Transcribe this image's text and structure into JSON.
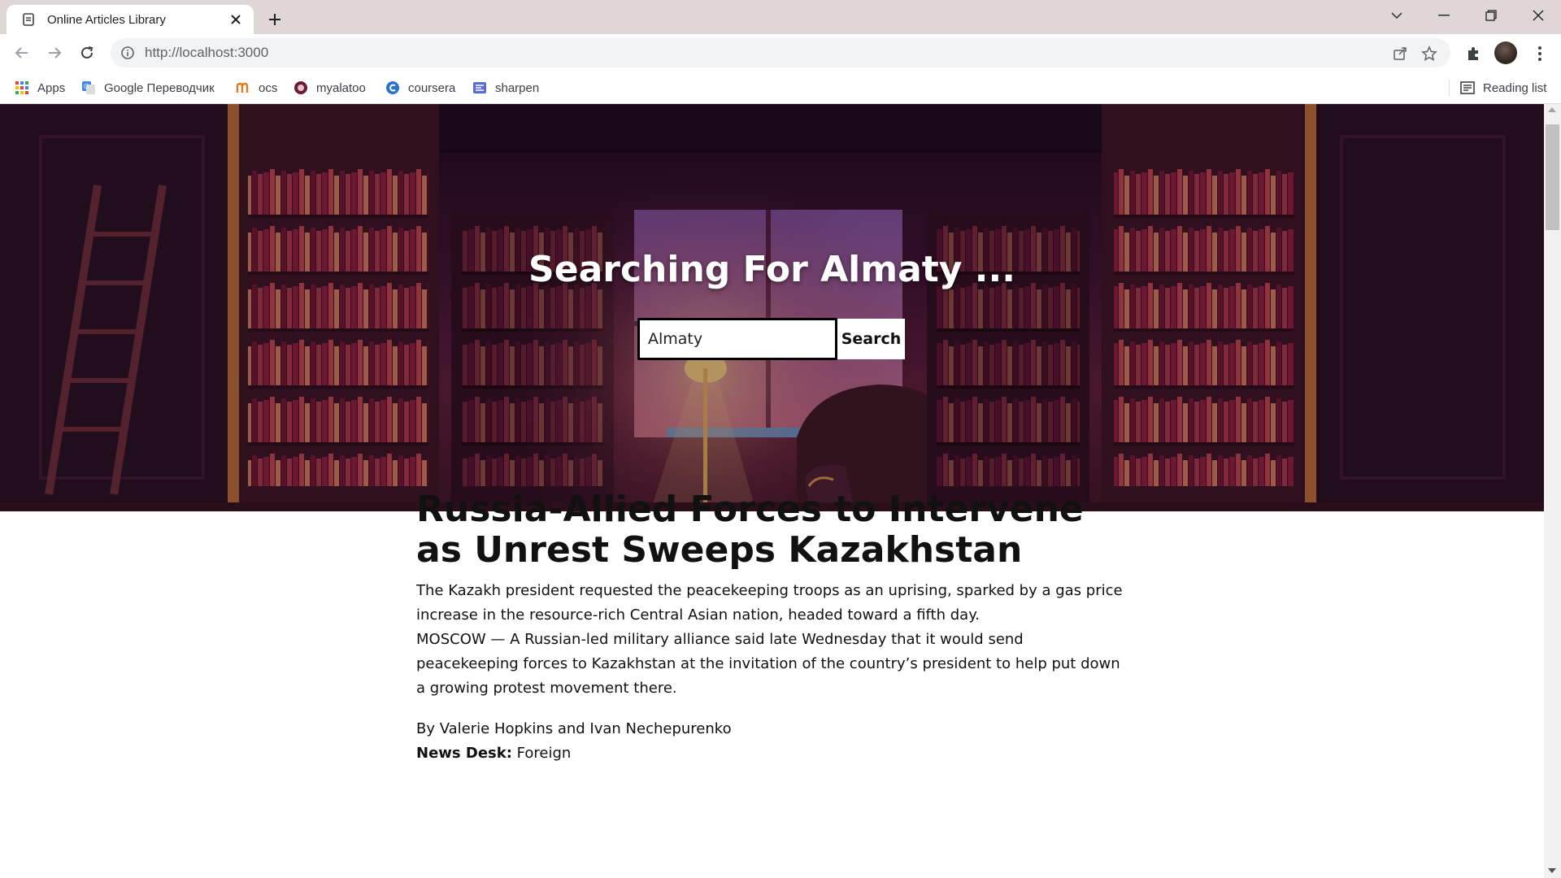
{
  "browser": {
    "tab_title": "Online Articles Library",
    "url": "http://localhost:3000",
    "bookmarks": [
      {
        "label": "Apps",
        "icon": "apps-grid-icon"
      },
      {
        "label": "Google Переводчик",
        "icon": "google-translate-icon"
      },
      {
        "label": "ocs",
        "icon": "ocs-icon"
      },
      {
        "label": "myalatoo",
        "icon": "myalatoo-icon"
      },
      {
        "label": "coursera",
        "icon": "coursera-icon"
      },
      {
        "label": "sharpen",
        "icon": "sharpen-icon"
      }
    ],
    "reading_list": "Reading list"
  },
  "hero": {
    "heading": "Searching For Almaty ...",
    "search_value": "Almaty",
    "search_button": "Search"
  },
  "article": {
    "headline": "Russia-Allied Forces to Intervene as Unrest Sweeps Kazakhstan",
    "lead_paragraph": "The Kazakh president requested the peacekeeping troops as an uprising, sparked by a gas price increase in the resource-rich Central Asian nation, headed toward a fifth day.",
    "snippet": "MOSCOW — A Russian-led military alliance said late Wednesday that it would send peacekeeping forces to Kazakhstan at the invitation of the country’s president to help put down a growing protest movement there.",
    "byline": "By Valerie Hopkins and Ivan Nechepurenko",
    "news_desk_label": "News Desk:",
    "news_desk_value": "Foreign"
  },
  "colors": {
    "tabbar_bg": "#dfd6d6",
    "omnibox_bg": "#f1f3f4",
    "hero_tint": "#3a1230",
    "lamp_glow": "#e8c37a"
  }
}
